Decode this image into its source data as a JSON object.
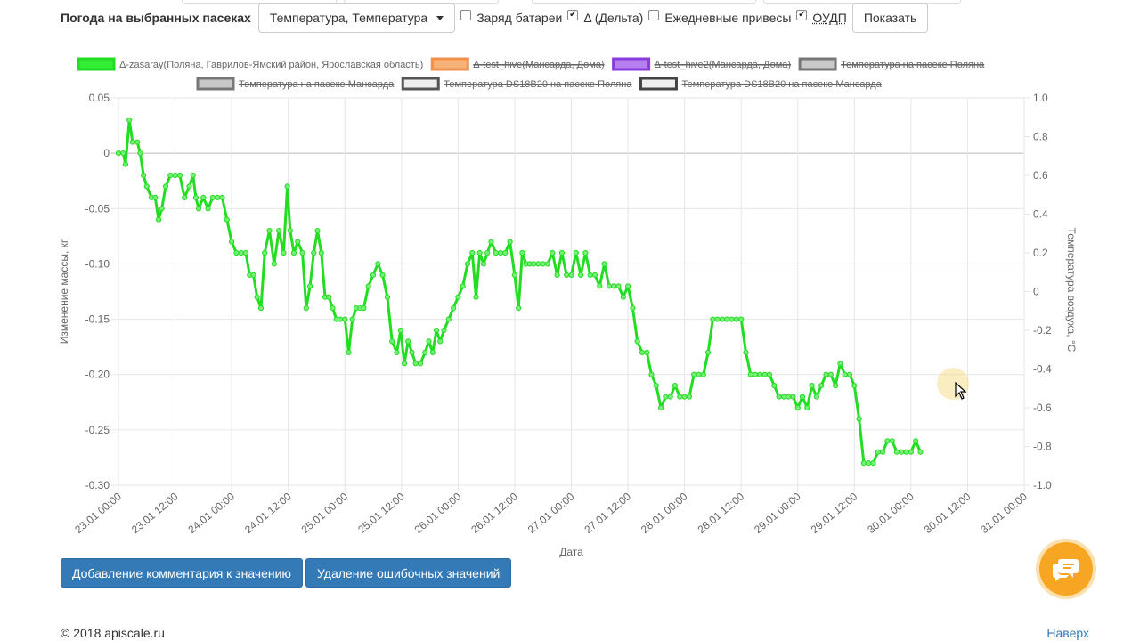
{
  "toolbar": {
    "title": "Погода на выбранных пасеках",
    "dropdown_value": "Температура, Температура",
    "checkboxes": [
      {
        "label": "Заряд батареи",
        "checked": false
      },
      {
        "label": "Δ (Дельта)",
        "checked": true
      },
      {
        "label": "Ежедневные привесы",
        "checked": false
      },
      {
        "label": "ОУДП",
        "checked": true
      }
    ],
    "show_button": "Показать"
  },
  "chart_data": {
    "type": "line",
    "legend": [
      {
        "label": "Δ-zasaray(Поляна, Гаврилов-Ямский район, Ярославская область)",
        "color": "#33ee33",
        "border": "#22dd22",
        "hidden": false
      },
      {
        "label": "Δ-test_hive(Мансарда, Дома)",
        "color": "#f7b27a",
        "border": "#f0904a",
        "hidden": true
      },
      {
        "label": "Δ-test_hive2(Мансарда, Дома)",
        "color": "#b57ff0",
        "border": "#8a3be0",
        "hidden": true
      },
      {
        "label": "Температура на пасеке Поляна",
        "color": "#c8c8c8",
        "border": "#777777",
        "hidden": true
      },
      {
        "label": "Температура на пасеке Мансарда",
        "color": "#c8c8c8",
        "border": "#777777",
        "hidden": true
      },
      {
        "label": "Температура DS18B20 на пасеке Поляна",
        "color": "#eeeeee",
        "border": "#555555",
        "hidden": true
      },
      {
        "label": "Температура DS18B20 на пасеке Мансарда",
        "color": "#eeeeee",
        "border": "#444444",
        "hidden": true
      }
    ],
    "xlabel": "Дата",
    "ylabel_left": "Изменение массы, кг",
    "ylabel_right": "Температура воздуха, °C",
    "x_ticks": [
      "23.01 00:00",
      "23.01 12:00",
      "24.01 00:00",
      "24.01 12:00",
      "25.01 00:00",
      "25.01 12:00",
      "26.01 00:00",
      "26.01 12:00",
      "27.01 00:00",
      "27.01 12:00",
      "28.01 00:00",
      "28.01 12:00",
      "29.01 00:00",
      "29.01 12:00",
      "30.01 00:00",
      "30.01 12:00",
      "31.01 00:00"
    ],
    "y_left_ticks": [
      "0.05",
      "0",
      "-0.05",
      "-0.10",
      "-0.15",
      "-0.20",
      "-0.25",
      "-0.30"
    ],
    "y_right_ticks": [
      "1.0",
      "0.8",
      "0.6",
      "0.4",
      "0.2",
      "0",
      "-0.2",
      "-0.4",
      "-0.6",
      "-0.8",
      "-1.0"
    ],
    "ylim_left": [
      -0.3,
      0.05
    ],
    "ylim_right": [
      -1.0,
      1.0
    ],
    "xlim_hours": [
      0,
      192
    ],
    "x_hours": [
      0,
      1,
      2,
      3,
      4,
      5,
      6,
      7,
      8,
      9,
      10,
      11,
      12,
      13,
      14,
      15,
      16,
      17,
      18,
      19,
      20,
      21,
      22,
      23,
      24,
      25,
      26,
      27,
      28,
      29,
      30,
      31,
      32,
      33,
      34,
      35,
      36,
      37,
      38,
      39,
      40,
      41,
      42,
      43,
      44,
      45,
      46,
      47,
      48,
      49,
      50,
      51,
      52,
      53,
      54,
      55,
      56,
      57,
      58,
      59,
      60,
      61,
      62,
      63,
      64,
      65,
      66,
      67,
      68,
      69,
      70,
      71,
      72,
      73,
      74,
      75,
      76,
      77,
      78,
      79,
      80,
      81,
      82,
      83,
      84,
      85,
      86,
      87,
      88,
      89,
      90,
      91,
      92,
      93,
      94,
      95,
      96,
      97,
      98,
      99,
      100,
      101,
      102,
      103,
      104,
      105,
      106,
      107,
      108,
      109,
      110,
      111,
      112,
      113,
      114,
      115,
      116,
      117,
      118,
      119,
      120,
      121,
      122,
      123,
      124,
      125,
      126,
      127,
      128,
      129,
      130,
      131,
      132,
      133,
      134,
      135,
      136,
      137,
      138,
      139,
      140,
      141,
      142,
      143,
      144,
      145,
      146,
      147,
      148,
      149,
      150,
      151,
      152,
      153,
      154,
      155,
      156,
      157,
      158,
      159,
      160,
      161,
      162,
      163,
      164,
      165,
      166,
      167,
      168,
      169,
      170,
      171,
      172,
      173,
      174,
      175,
      176,
      177,
      178,
      179,
      180,
      181,
      182,
      183,
      184,
      185,
      186,
      187,
      188,
      189,
      190,
      191,
      192
    ],
    "series": [
      {
        "name": "Δ-zasaray(Поляна, Гаврилов-Ямский район, Ярославская область)",
        "color": "#22dd22",
        "points": [
          [
            0,
            0
          ],
          [
            1,
            0
          ],
          [
            1.5,
            -0.01
          ],
          [
            2.3,
            0.03
          ],
          [
            3,
            0.01
          ],
          [
            4,
            0.01
          ],
          [
            4.6,
            0
          ],
          [
            5.3,
            -0.02
          ],
          [
            6,
            -0.03
          ],
          [
            7,
            -0.04
          ],
          [
            7.8,
            -0.04
          ],
          [
            8.5,
            -0.06
          ],
          [
            9.2,
            -0.05
          ],
          [
            10,
            -0.03
          ],
          [
            11,
            -0.02
          ],
          [
            12,
            -0.02
          ],
          [
            13,
            -0.02
          ],
          [
            14,
            -0.04
          ],
          [
            15,
            -0.03
          ],
          [
            15.8,
            -0.02
          ],
          [
            16.4,
            -0.04
          ],
          [
            17,
            -0.05
          ],
          [
            18,
            -0.04
          ],
          [
            19,
            -0.05
          ],
          [
            20,
            -0.04
          ],
          [
            21,
            -0.04
          ],
          [
            22,
            -0.04
          ],
          [
            23,
            -0.06
          ],
          [
            24,
            -0.08
          ],
          [
            25,
            -0.09
          ],
          [
            26,
            -0.09
          ],
          [
            27,
            -0.09
          ],
          [
            27.8,
            -0.11
          ],
          [
            28.6,
            -0.11
          ],
          [
            29.4,
            -0.13
          ],
          [
            30.2,
            -0.14
          ],
          [
            31,
            -0.09
          ],
          [
            32,
            -0.07
          ],
          [
            33,
            -0.1
          ],
          [
            34,
            -0.07
          ],
          [
            35,
            -0.09
          ],
          [
            35.8,
            -0.03
          ],
          [
            36.4,
            -0.07
          ],
          [
            37.2,
            -0.09
          ],
          [
            38,
            -0.08
          ],
          [
            39,
            -0.09
          ],
          [
            39.8,
            -0.14
          ],
          [
            40.6,
            -0.12
          ],
          [
            41.4,
            -0.09
          ],
          [
            42.2,
            -0.07
          ],
          [
            43,
            -0.09
          ],
          [
            43.8,
            -0.13
          ],
          [
            44.6,
            -0.13
          ],
          [
            45.4,
            -0.14
          ],
          [
            46.2,
            -0.15
          ],
          [
            47,
            -0.15
          ],
          [
            48,
            -0.15
          ],
          [
            48.8,
            -0.18
          ],
          [
            49.6,
            -0.15
          ],
          [
            50.4,
            -0.14
          ],
          [
            51.2,
            -0.14
          ],
          [
            52,
            -0.14
          ],
          [
            53,
            -0.12
          ],
          [
            54,
            -0.11
          ],
          [
            55,
            -0.1
          ],
          [
            56,
            -0.11
          ],
          [
            57,
            -0.13
          ],
          [
            58,
            -0.17
          ],
          [
            59,
            -0.18
          ],
          [
            59.8,
            -0.16
          ],
          [
            60.6,
            -0.19
          ],
          [
            61.4,
            -0.17
          ],
          [
            62.2,
            -0.18
          ],
          [
            63,
            -0.19
          ],
          [
            64,
            -0.19
          ],
          [
            65,
            -0.18
          ],
          [
            65.8,
            -0.17
          ],
          [
            66.6,
            -0.18
          ],
          [
            67.4,
            -0.16
          ],
          [
            68.2,
            -0.17
          ],
          [
            69,
            -0.16
          ],
          [
            70,
            -0.15
          ],
          [
            71,
            -0.14
          ],
          [
            72,
            -0.13
          ],
          [
            73,
            -0.12
          ],
          [
            74,
            -0.1
          ],
          [
            75,
            -0.09
          ],
          [
            75.8,
            -0.13
          ],
          [
            76.6,
            -0.09
          ],
          [
            77.4,
            -0.1
          ],
          [
            78.2,
            -0.09
          ],
          [
            79,
            -0.08
          ],
          [
            80,
            -0.09
          ],
          [
            81,
            -0.09
          ],
          [
            82,
            -0.09
          ],
          [
            83,
            -0.08
          ],
          [
            84,
            -0.11
          ],
          [
            84.8,
            -0.14
          ],
          [
            85.6,
            -0.09
          ],
          [
            86.4,
            -0.1
          ],
          [
            87.2,
            -0.1
          ],
          [
            88,
            -0.1
          ],
          [
            89,
            -0.1
          ],
          [
            90,
            -0.1
          ],
          [
            91,
            -0.1
          ],
          [
            92,
            -0.09
          ],
          [
            93,
            -0.11
          ],
          [
            94,
            -0.09
          ],
          [
            95,
            -0.11
          ],
          [
            96,
            -0.11
          ],
          [
            97,
            -0.09
          ],
          [
            98,
            -0.11
          ],
          [
            99,
            -0.09
          ],
          [
            100,
            -0.11
          ],
          [
            101,
            -0.11
          ],
          [
            102,
            -0.12
          ],
          [
            103,
            -0.1
          ],
          [
            104,
            -0.12
          ],
          [
            105,
            -0.12
          ],
          [
            106,
            -0.12
          ],
          [
            107,
            -0.13
          ],
          [
            108,
            -0.12
          ],
          [
            109,
            -0.14
          ],
          [
            110,
            -0.17
          ],
          [
            111,
            -0.18
          ],
          [
            112,
            -0.18
          ],
          [
            113,
            -0.2
          ],
          [
            114,
            -0.21
          ],
          [
            115,
            -0.23
          ],
          [
            116,
            -0.22
          ],
          [
            117,
            -0.22
          ],
          [
            118,
            -0.21
          ],
          [
            119,
            -0.22
          ],
          [
            120,
            -0.22
          ],
          [
            121,
            -0.22
          ],
          [
            122,
            -0.2
          ],
          [
            123,
            -0.2
          ],
          [
            124,
            -0.2
          ],
          [
            125,
            -0.18
          ],
          [
            126,
            -0.15
          ],
          [
            127,
            -0.15
          ],
          [
            128,
            -0.15
          ],
          [
            129,
            -0.15
          ],
          [
            130,
            -0.15
          ],
          [
            131,
            -0.15
          ],
          [
            132,
            -0.15
          ],
          [
            133,
            -0.18
          ],
          [
            134,
            -0.2
          ],
          [
            135,
            -0.2
          ],
          [
            136,
            -0.2
          ],
          [
            137,
            -0.2
          ],
          [
            138,
            -0.2
          ],
          [
            139,
            -0.21
          ],
          [
            140,
            -0.22
          ],
          [
            141,
            -0.22
          ],
          [
            142,
            -0.22
          ],
          [
            143,
            -0.22
          ],
          [
            144,
            -0.23
          ],
          [
            145,
            -0.22
          ],
          [
            146,
            -0.23
          ],
          [
            147,
            -0.21
          ],
          [
            148,
            -0.22
          ],
          [
            149,
            -0.21
          ],
          [
            150,
            -0.2
          ],
          [
            151,
            -0.2
          ],
          [
            152,
            -0.21
          ],
          [
            153,
            -0.19
          ],
          [
            154,
            -0.2
          ],
          [
            155,
            -0.2
          ],
          [
            156,
            -0.21
          ],
          [
            157,
            -0.24
          ],
          [
            158,
            -0.28
          ],
          [
            159,
            -0.28
          ],
          [
            160,
            -0.28
          ],
          [
            161,
            -0.27
          ],
          [
            162,
            -0.27
          ],
          [
            163,
            -0.26
          ],
          [
            164,
            -0.26
          ],
          [
            165,
            -0.27
          ],
          [
            166,
            -0.27
          ],
          [
            167,
            -0.27
          ],
          [
            168,
            -0.27
          ],
          [
            169,
            -0.26
          ],
          [
            170,
            -0.27
          ]
        ]
      }
    ]
  },
  "buttons": {
    "add_comment": "Добавление комментария к значению",
    "delete_errors": "Удаление ошибочных значений"
  },
  "footer": {
    "copyright": "© 2018 apiscale.ru",
    "to_top": "Наверх"
  },
  "icons": {
    "chat": "chat-bubble-icon",
    "cursor": "mouse-pointer-icon"
  }
}
